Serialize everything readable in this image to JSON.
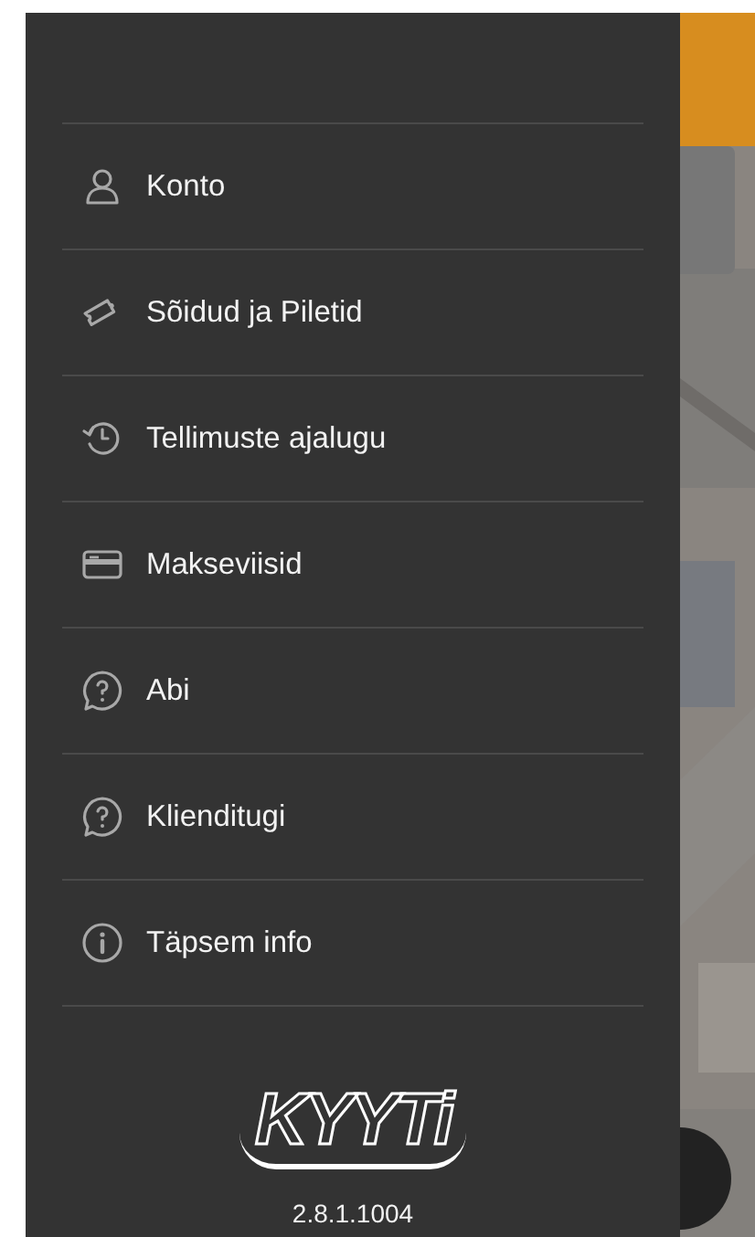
{
  "menu": {
    "items": [
      {
        "kind": "account",
        "label": "Konto"
      },
      {
        "kind": "ticket",
        "label": "Sõidud ja Piletid"
      },
      {
        "kind": "history",
        "label": "Tellimuste ajalugu"
      },
      {
        "kind": "card",
        "label": "Makseviisid"
      },
      {
        "kind": "help",
        "label": "Abi"
      },
      {
        "kind": "help",
        "label": "Klienditugi"
      },
      {
        "kind": "info",
        "label": "Täpsem info"
      }
    ]
  },
  "logo": "KYYTi",
  "version": "2.8.1.1004"
}
